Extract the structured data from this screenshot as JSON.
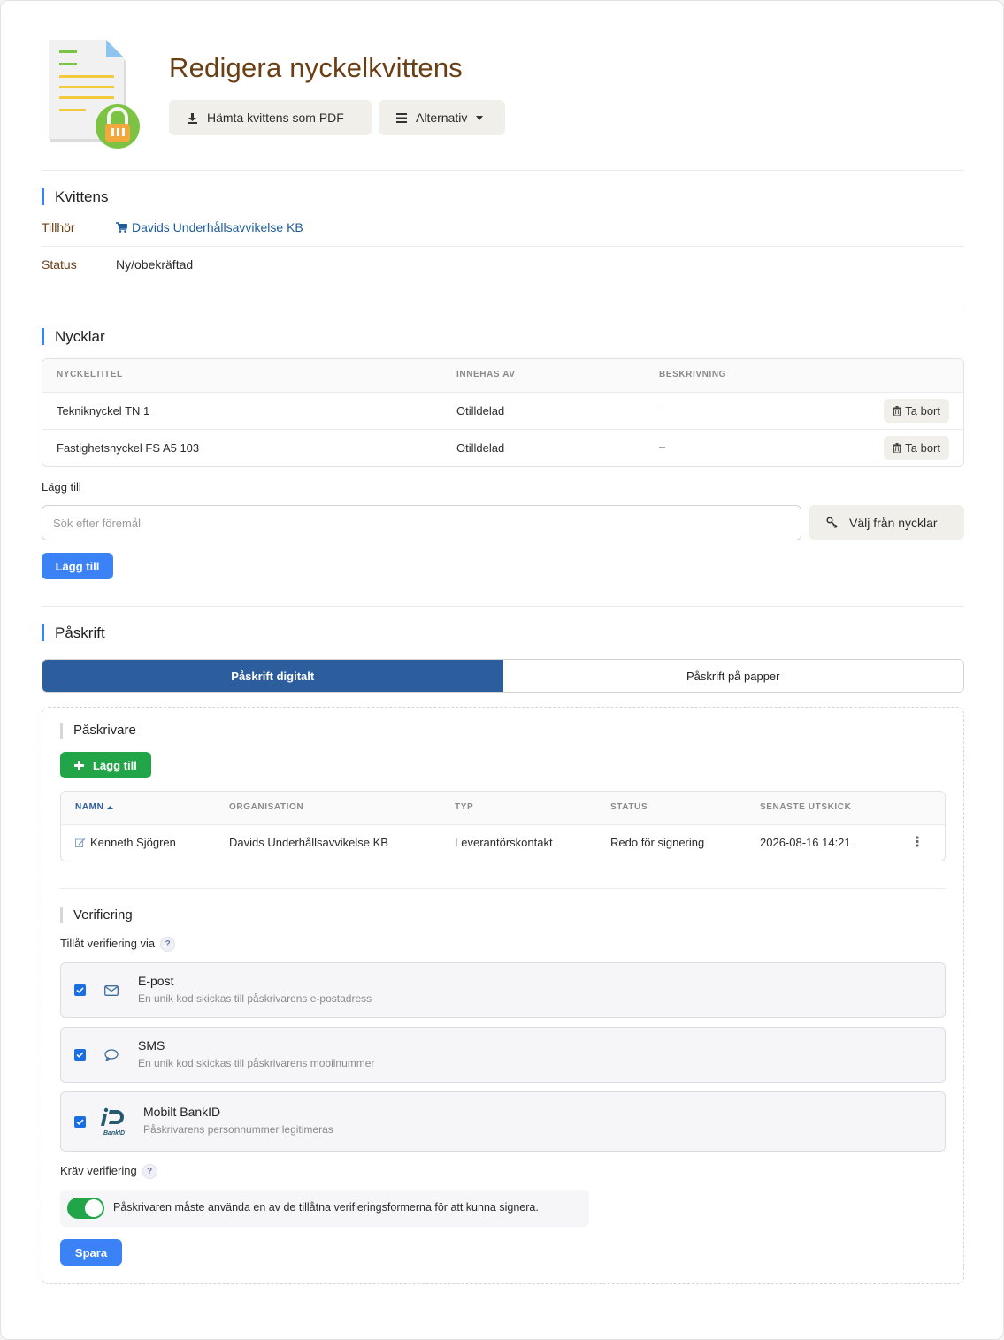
{
  "header": {
    "title": "Redigera nyckelkvittens",
    "pdf_button": "Hämta kvittens som PDF",
    "options_button": "Alternativ"
  },
  "receipt": {
    "heading": "Kvittens",
    "belongs_label": "Tillhör",
    "belongs_value": "Davids Underhållsavvikelse KB",
    "status_label": "Status",
    "status_value": "Ny/obekräftad"
  },
  "keys": {
    "heading": "Nycklar",
    "columns": [
      "NYCKELTITEL",
      "INNEHAS AV",
      "BESKRIVNING"
    ],
    "rows": [
      {
        "title": "Tekniknyckel TN 1",
        "holder": "Otilldelad",
        "description": "–",
        "action": "Ta bort"
      },
      {
        "title": "Fastighetsnyckel FS A5 103",
        "holder": "Otilldelad",
        "description": "–",
        "action": "Ta bort"
      }
    ],
    "add_label": "Lägg till",
    "search_placeholder": "Sök efter föremål",
    "choose_button": "Välj från nycklar",
    "add_button": "Lägg till"
  },
  "signature": {
    "heading": "Påskrift",
    "tabs": [
      {
        "label": "Påskrift digitalt",
        "active": true
      },
      {
        "label": "Påskrift på papper",
        "active": false
      }
    ],
    "signers": {
      "heading": "Påskrivare",
      "add_button": "Lägg till",
      "columns": [
        "NAMN",
        "ORGANISATION",
        "TYP",
        "STATUS",
        "SENASTE UTSKICK"
      ],
      "rows": [
        {
          "name": "Kenneth Sjögren",
          "organisation": "Davids Underhållsavvikelse KB",
          "type": "Leverantörskontakt",
          "status": "Redo för signering",
          "last_sent": "2026-08-16 14:21"
        }
      ]
    },
    "verification": {
      "heading": "Verifiering",
      "allow_label": "Tillåt verifiering via",
      "help": "?",
      "options": [
        {
          "title": "E-post",
          "desc": "En unik kod skickas till påskrivarens e-postadress",
          "checked": true,
          "icon": "envelope-icon"
        },
        {
          "title": "SMS",
          "desc": "En unik kod skickas till påskrivarens mobilnummer",
          "checked": true,
          "icon": "chat-bubble-icon"
        },
        {
          "title": "Mobilt BankID",
          "desc": "Påskrivarens personnummer legitimeras",
          "checked": true,
          "icon": "bankid-logo"
        }
      ],
      "require_label": "Kräv verifiering",
      "require_text": "Påskrivaren måste använda en av de tillåtna verifieringsformerna för att kunna signera.",
      "require_on": true,
      "bankid_logo_text": "BankID"
    },
    "save_button": "Spara"
  },
  "colors": {
    "title": "#6b3f14",
    "accent_blue": "#3b82f6",
    "tab_active": "#2c5d9c",
    "green": "#21a548",
    "link": "#1f5c99"
  }
}
